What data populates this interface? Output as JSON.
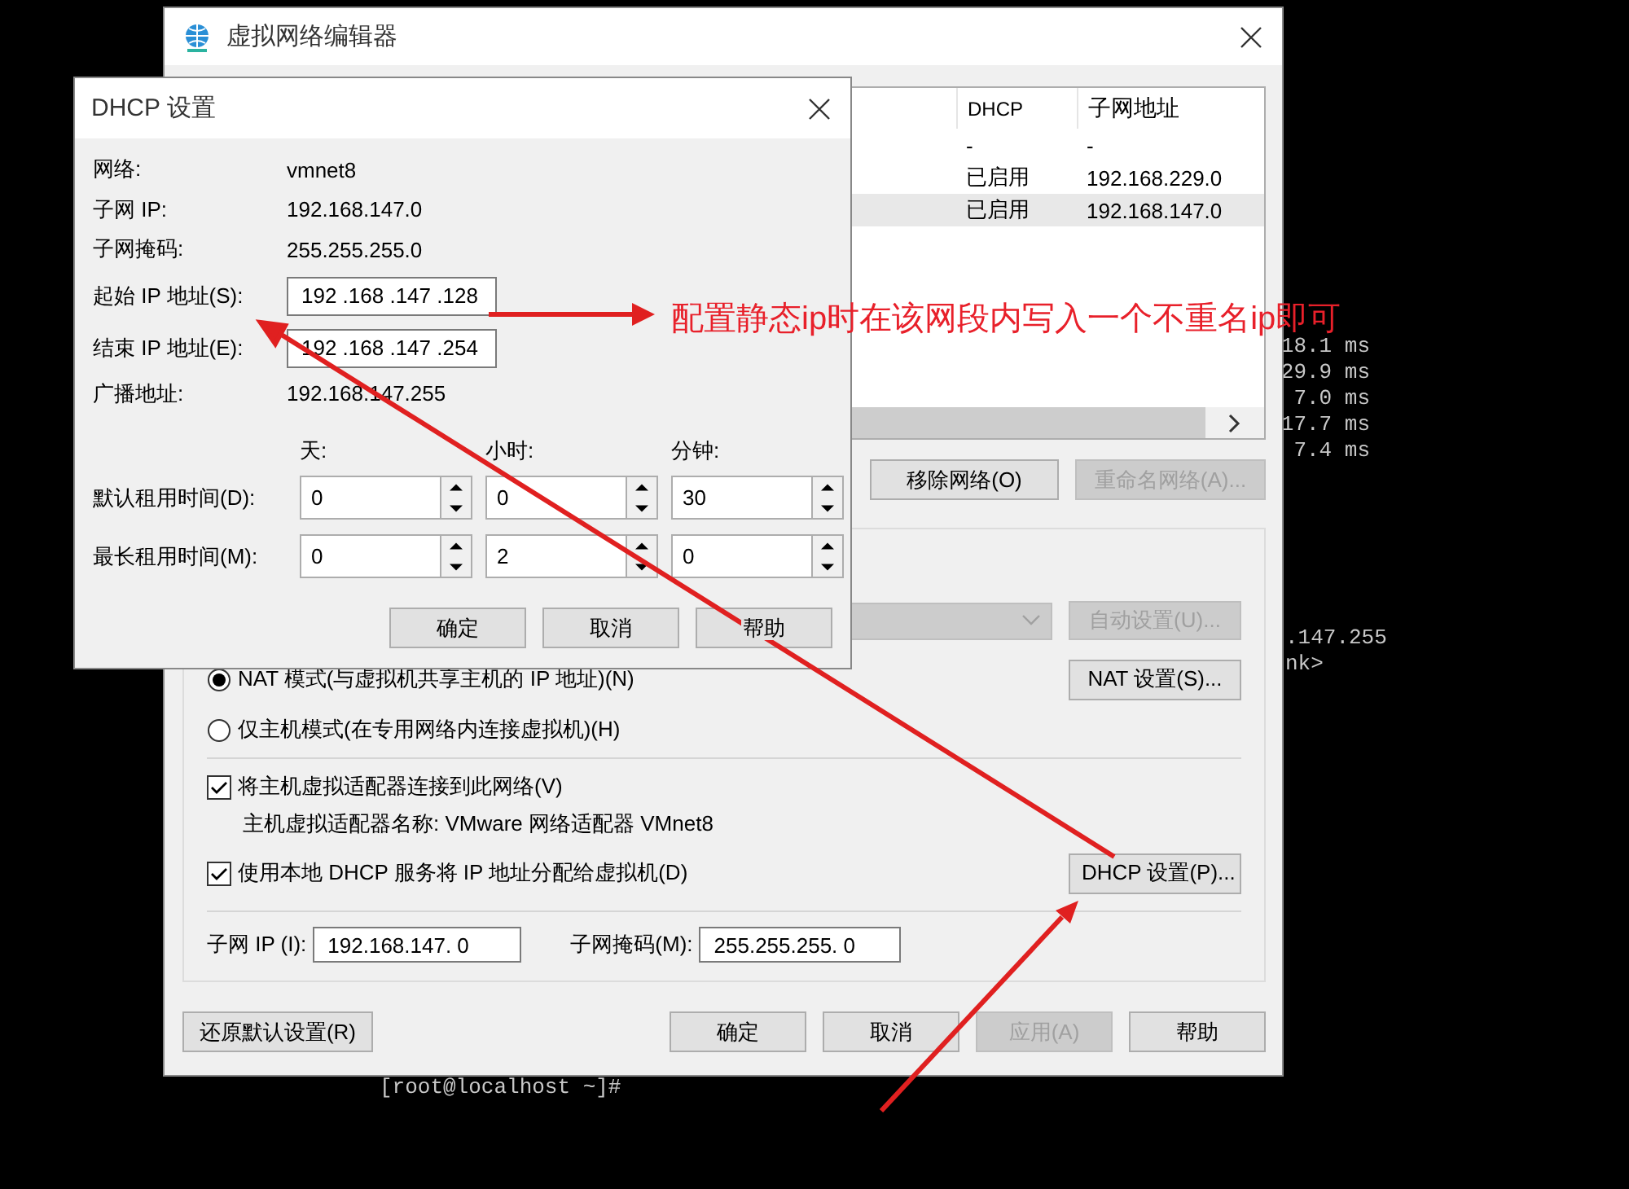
{
  "terminal": {
    "upper_lines": [
      "18.1 ms",
      "29.9 ms",
      "7.0 ms",
      "17.7 ms",
      "7.4 ms"
    ],
    "lower_lines": [
      ".147.255",
      "nk>"
    ],
    "prompt": "[root@localhost ~]#"
  },
  "main_window": {
    "title": "虚拟网络编辑器",
    "table": {
      "columns": [
        "DHCP",
        "子网地址"
      ],
      "rows": [
        {
          "cells": [
            "-",
            "-"
          ],
          "selected": false
        },
        {
          "cells": [
            "已启用",
            "192.168.229.0"
          ],
          "selected": false
        },
        {
          "cells": [
            "已启用",
            "192.168.147.0"
          ],
          "selected": true
        }
      ]
    },
    "network_buttons": [
      {
        "label": "移除网络(O)",
        "disabled": false
      },
      {
        "label": "重命名网络(A)...",
        "disabled": true
      }
    ],
    "bridge_select": {
      "disabled": true
    },
    "auto_button": {
      "label": "自动设置(U)...",
      "disabled": true
    },
    "modes": [
      {
        "label": "NAT 模式(与虚拟机共享主机的 IP 地址)(N)",
        "selected": true
      },
      {
        "label": "仅主机模式(在专用网络内连接虚拟机)(H)",
        "selected": false
      }
    ],
    "nat_button": {
      "label": "NAT 设置(S)...",
      "disabled": false
    },
    "options": [
      {
        "label": "将主机虚拟适配器连接到此网络(V)",
        "checked": true
      },
      {
        "label": "使用本地 DHCP 服务将 IP 地址分配给虚拟机(D)",
        "checked": true
      }
    ],
    "adapter_name": "主机虚拟适配器名称: VMware 网络适配器 VMnet8",
    "dhcp_button": {
      "label": "DHCP 设置(P)...",
      "disabled": false
    },
    "subnet_ip": {
      "label": "子网 IP (I):",
      "value": "192.168.147. 0"
    },
    "subnet_mask": {
      "label": "子网掩码(M):",
      "value": "255.255.255. 0"
    },
    "restore_button": {
      "label": "还原默认设置(R)",
      "disabled": false
    },
    "footer_buttons": [
      {
        "label": "确定",
        "disabled": false
      },
      {
        "label": "取消",
        "disabled": false
      },
      {
        "label": "应用(A)",
        "disabled": true
      },
      {
        "label": "帮助",
        "disabled": false
      }
    ]
  },
  "dhcp_dialog": {
    "title": "DHCP 设置",
    "rows": [
      {
        "kind": "info",
        "label": "网络:",
        "value": "vmnet8"
      },
      {
        "kind": "info",
        "label": "子网 IP:",
        "value": "192.168.147.0"
      },
      {
        "kind": "info",
        "label": "子网掩码:",
        "value": "255.255.255.0"
      },
      {
        "kind": "field",
        "label": "起始 IP 地址(S):",
        "value": "192 .168 .147 .128"
      },
      {
        "kind": "field",
        "label": "结束 IP 地址(E):",
        "value": "192 .168 .147 .254"
      },
      {
        "kind": "info",
        "label": "广播地址:",
        "value": "192.168.147.255"
      }
    ],
    "lease_headers": [
      "天:",
      "小时:",
      "分钟:"
    ],
    "lease_rows": [
      {
        "label": "默认租用时间(D):",
        "values": [
          "0",
          "0",
          "30"
        ]
      },
      {
        "label": "最长租用时间(M):",
        "values": [
          "0",
          "2",
          "0"
        ]
      }
    ],
    "buttons": [
      {
        "label": "确定",
        "disabled": false
      },
      {
        "label": "取消",
        "disabled": false
      },
      {
        "label": "帮助",
        "disabled": false
      }
    ]
  },
  "annotation": {
    "text": "配置静态ip时在该网段内写入一个不重名ip即可"
  }
}
